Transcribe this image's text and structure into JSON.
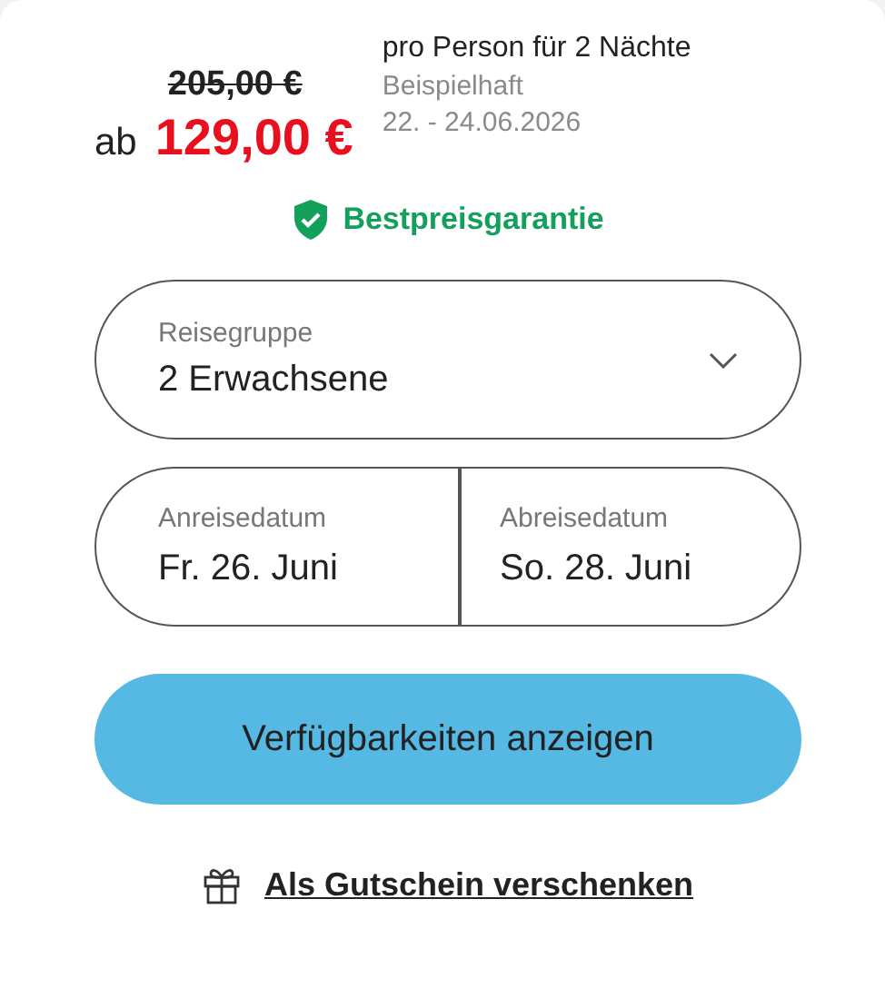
{
  "price": {
    "old": "205,00 €",
    "prefix": "ab",
    "current": "129,00 €",
    "per": "pro Person für 2 Nächte",
    "note": "Beispielhaft",
    "dates": "22. - 24.06.2026"
  },
  "guarantee": {
    "label": "Bestpreisgarantie"
  },
  "group_field": {
    "label": "Reisegruppe",
    "value": "2 Erwachsene"
  },
  "date_fields": [
    {
      "label": "Anreisedatum",
      "value": "Fr. 26. Juni"
    },
    {
      "label": "Abreisedatum",
      "value": "So. 28. Juni"
    }
  ],
  "submit": "Verfügbarkeiten anzeigen",
  "gift_link": "Als Gutschein verschenken"
}
